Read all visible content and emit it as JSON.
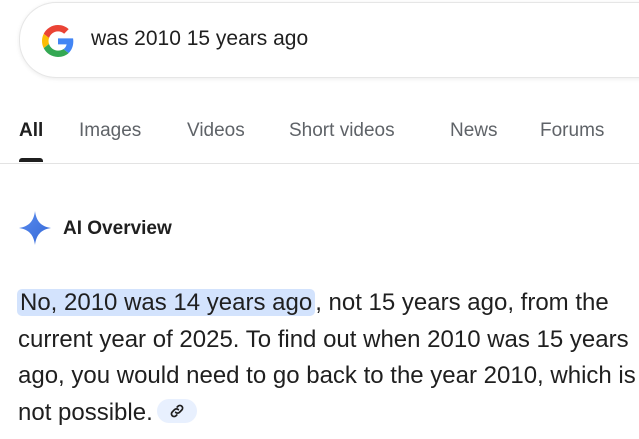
{
  "search": {
    "query": "was 2010 15 years ago"
  },
  "tabs": [
    {
      "label": "All",
      "active": true
    },
    {
      "label": "Images",
      "active": false
    },
    {
      "label": "Videos",
      "active": false
    },
    {
      "label": "Short videos",
      "active": false
    },
    {
      "label": "News",
      "active": false
    },
    {
      "label": "Forums",
      "active": false
    }
  ],
  "ai_overview": {
    "title": "AI Overview",
    "highlight": "No, 2010 was 14 years ago",
    "body": ", not 15 years ago, from the current year of 2025. To find out when 2010 was 15 years ago, you would need to go back to the year 2010, which is not possible."
  },
  "icons": {
    "logo": "google-g-icon",
    "sparkle": "ai-sparkle-icon",
    "link": "link-icon"
  },
  "colors": {
    "highlight_bg": "#d3e3fd",
    "sparkle_blue": "#4285f4",
    "active_tab": "#1f1f1f",
    "inactive_tab": "#5f6368"
  }
}
